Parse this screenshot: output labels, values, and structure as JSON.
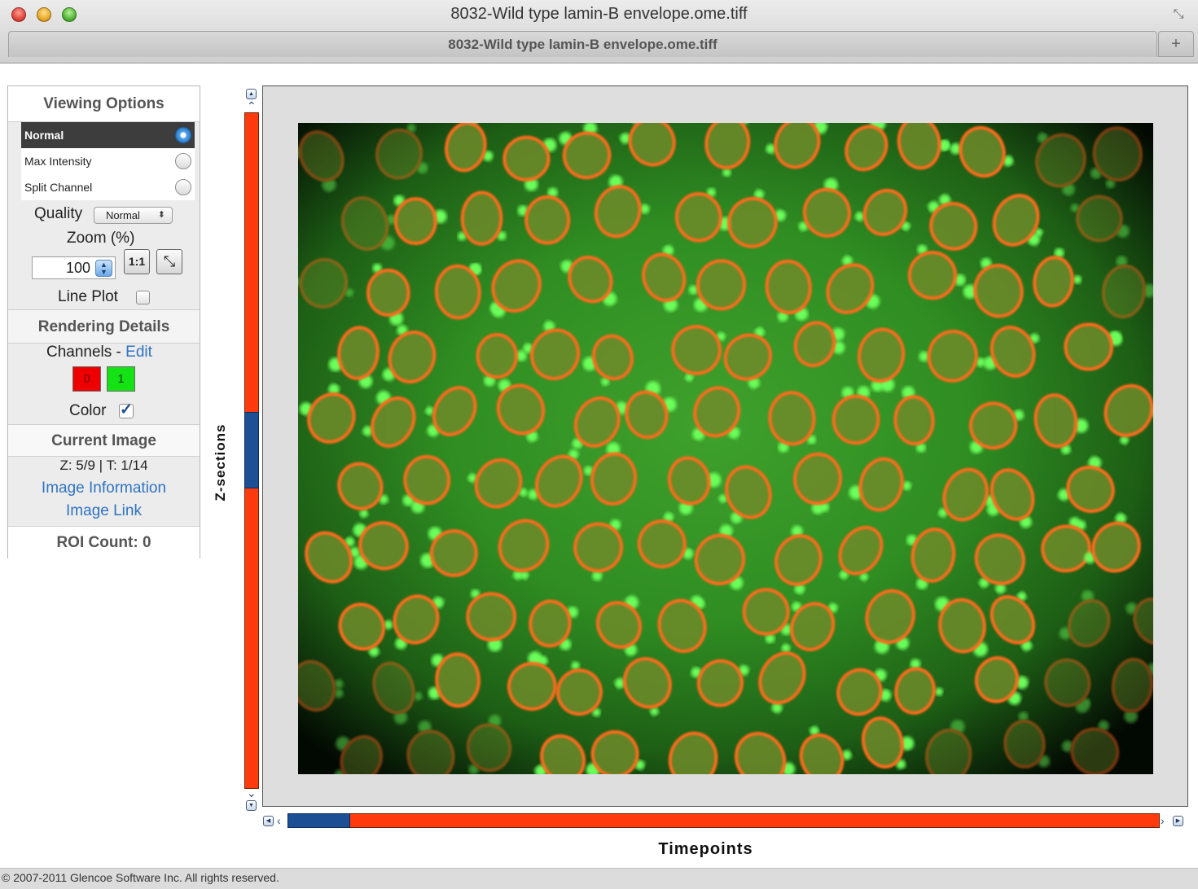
{
  "window": {
    "title": "8032-Wild type lamin-B envelope.ome.tiff",
    "tab_title": "8032-Wild type lamin-B envelope.ome.tiff"
  },
  "icons": {
    "fullscreen": "fullscreen-icon",
    "new_tab": "plus-icon",
    "zoom_actual": "one-to-one-icon",
    "zoom_fit": "fit-to-window-icon"
  },
  "viewing_options": {
    "header": "Viewing Options",
    "modes": [
      {
        "label": "Normal",
        "selected": true
      },
      {
        "label": "Max Intensity",
        "selected": false
      },
      {
        "label": "Split Channel",
        "selected": false
      }
    ],
    "quality_label": "Quality",
    "quality_value": "Normal",
    "zoom_label": "Zoom (%)",
    "zoom_value": "100",
    "zoom_actual_label": "1:1",
    "line_plot_label": "Line Plot",
    "line_plot_checked": false
  },
  "rendering_details": {
    "header": "Rendering Details",
    "channels_label": "Channels",
    "channels_separator": " - ",
    "edit_link": "Edit",
    "channels": [
      {
        "label": "0",
        "color": "#ee0000"
      },
      {
        "label": "1",
        "color": "#14e214"
      }
    ],
    "color_label": "Color",
    "color_checked": true
  },
  "current_image": {
    "header": "Current Image",
    "position": "Z: 5/9 | T: 1/14",
    "info_link": "Image Information",
    "image_link": "Image Link",
    "roi_count": "ROI Count: 0"
  },
  "z_slider": {
    "label": "Z-sections",
    "current": 5,
    "total": 9
  },
  "t_slider": {
    "label": "Timepoints",
    "current": 1,
    "total": 14
  },
  "colors": {
    "slider_track": "#ff3a0c",
    "slider_thumb": "#1c4f93",
    "link": "#2e73c4"
  },
  "footer": {
    "copyright": "© 2007-2011 Glencoe Software Inc. All rights reserved."
  }
}
